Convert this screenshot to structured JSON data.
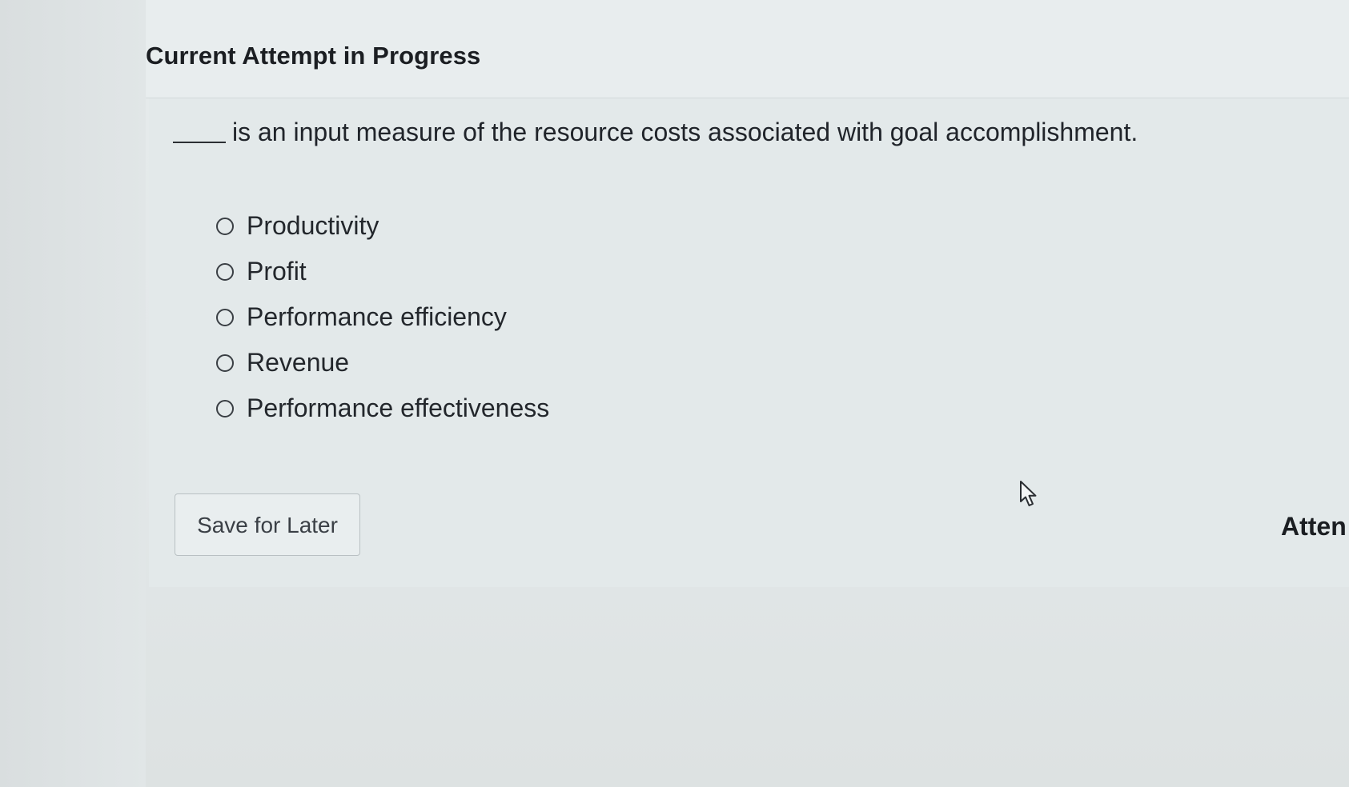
{
  "header": {
    "title": "Current Attempt in Progress"
  },
  "question": {
    "text": "is an input measure of the resource costs associated with goal accomplishment."
  },
  "options": [
    {
      "label": "Productivity",
      "selected": false
    },
    {
      "label": "Profit",
      "selected": false
    },
    {
      "label": "Performance efficiency",
      "selected": false
    },
    {
      "label": "Revenue",
      "selected": false
    },
    {
      "label": "Performance effectiveness",
      "selected": false
    }
  ],
  "actions": {
    "save_label": "Save for Later"
  },
  "attempts": {
    "label_visible": "Atten"
  },
  "icons": {
    "cursor": "arrow-pointer-icon",
    "radio": "radio-unselected-icon"
  }
}
